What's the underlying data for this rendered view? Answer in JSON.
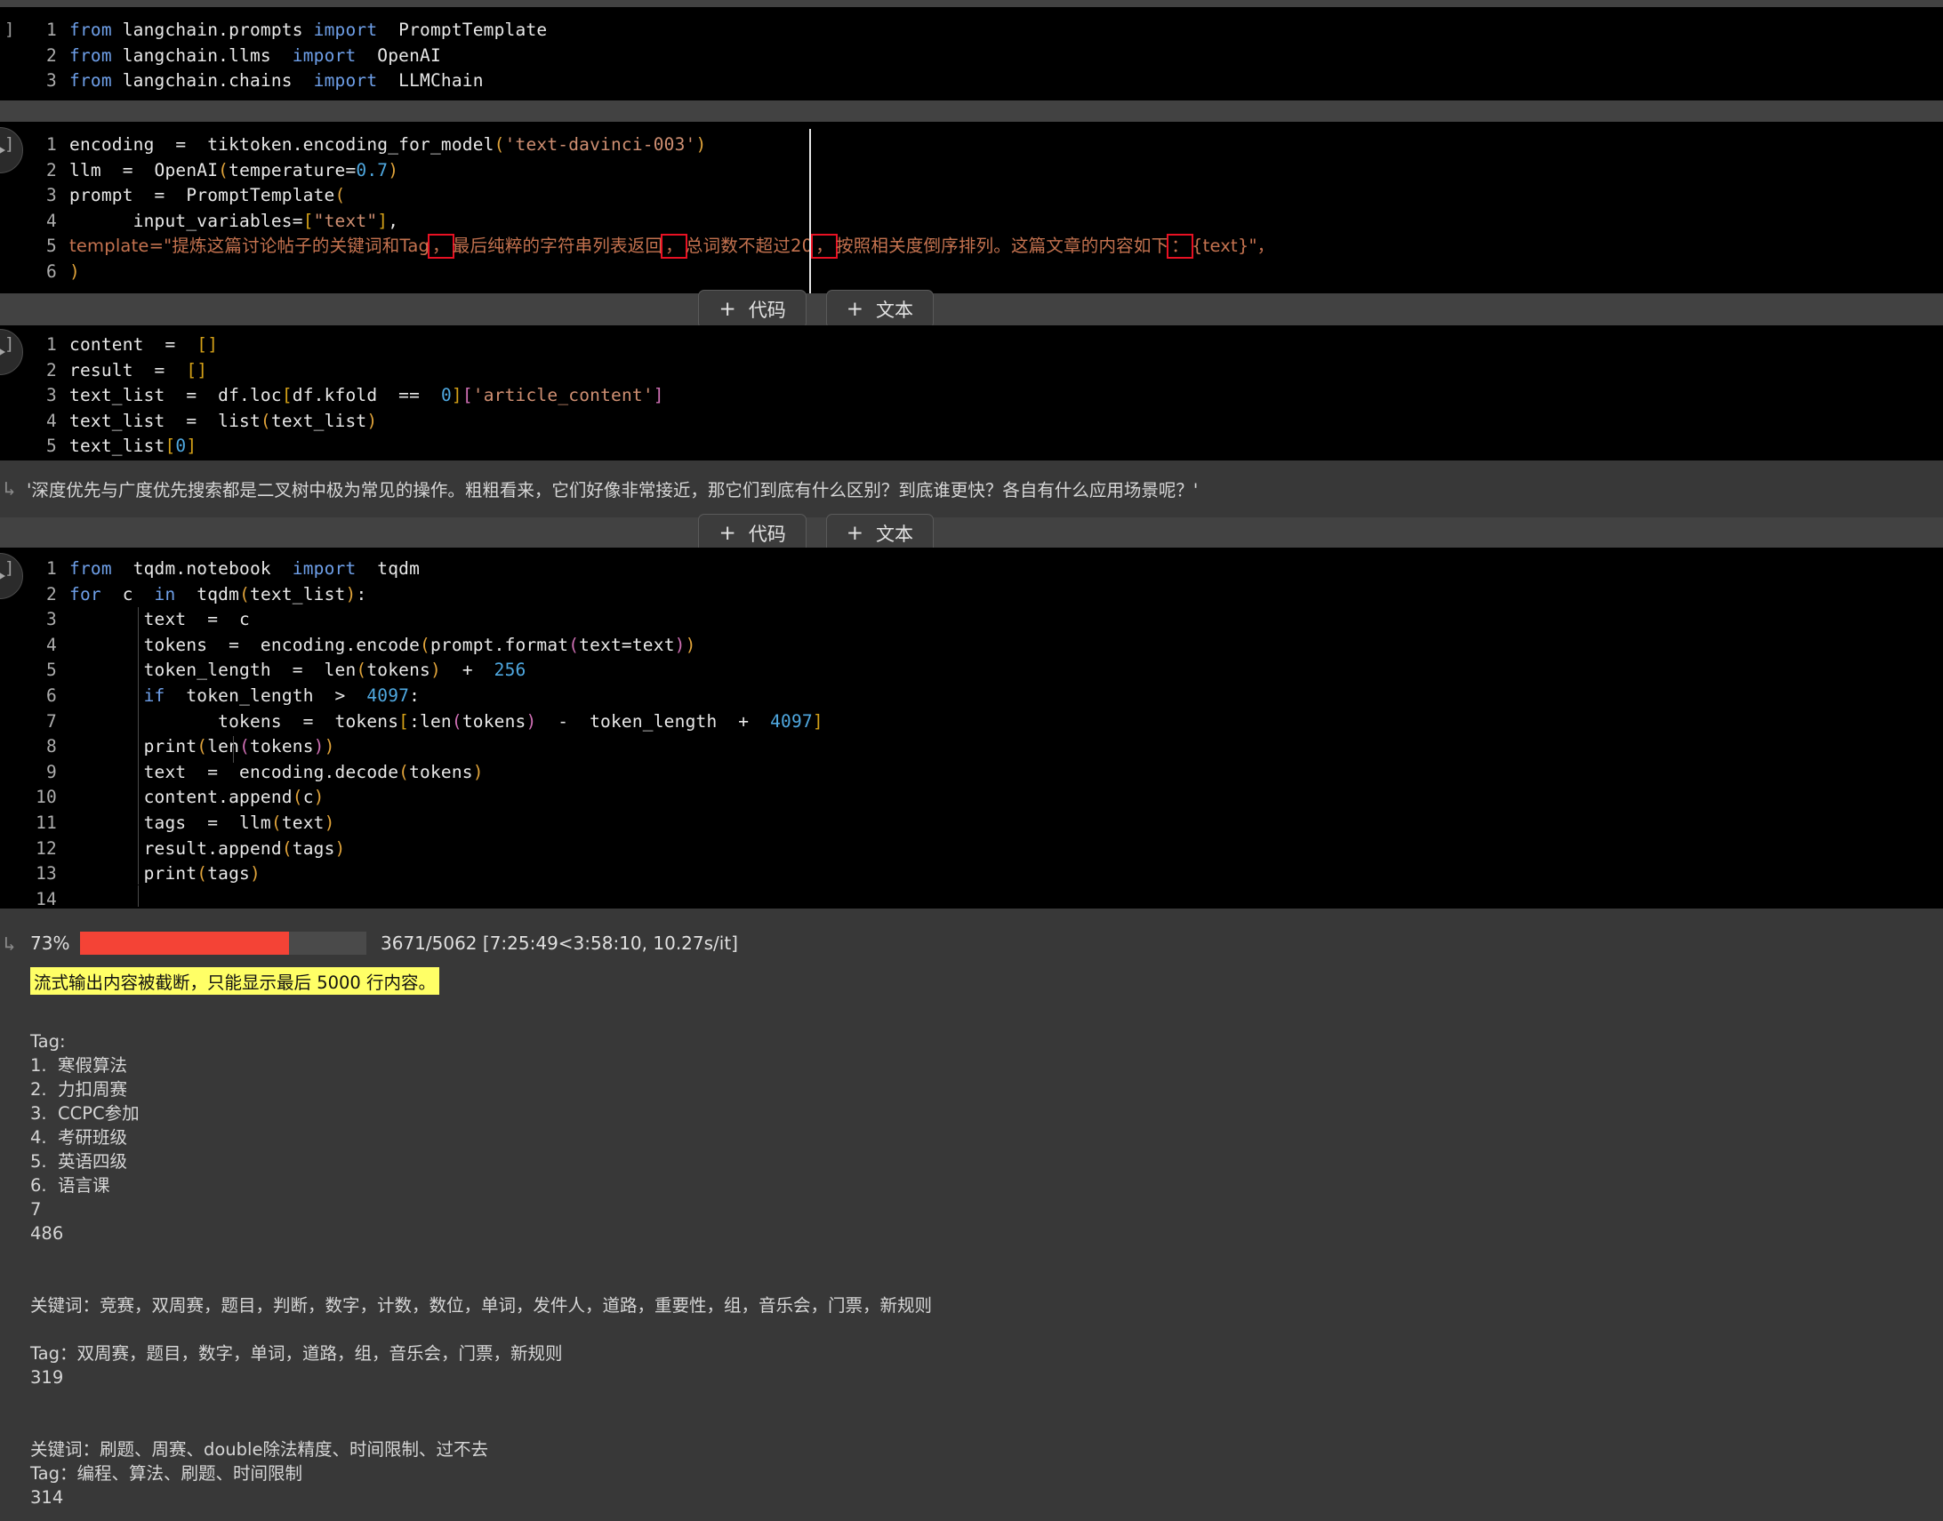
{
  "theme": {
    "page_bg": "#383838",
    "cell_bg": "#000000",
    "bar_bg": "#424242",
    "accent_red": "#f44336",
    "warn_bg": "#ffff66",
    "string_color": "#cf8f72",
    "keyword_color": "#6e9fe8"
  },
  "toolbar": {
    "add_code_label": "代码",
    "add_text_label": "文本",
    "plus": "+"
  },
  "cells": [
    {
      "id": "cell-imports",
      "prompt": "]",
      "lines": [
        {
          "n": "1",
          "tokens": [
            {
              "t": "from",
              "c": "kw"
            },
            {
              "t": " langchain.prompts ",
              "c": "plain"
            },
            {
              "t": "import",
              "c": "kw"
            },
            {
              "t": "  PromptTemplate",
              "c": "plain"
            }
          ]
        },
        {
          "n": "2",
          "tokens": [
            {
              "t": "from",
              "c": "kw"
            },
            {
              "t": " langchain.llms  ",
              "c": "plain"
            },
            {
              "t": "import",
              "c": "kw"
            },
            {
              "t": "  OpenAI",
              "c": "plain"
            }
          ]
        },
        {
          "n": "3",
          "tokens": [
            {
              "t": "from",
              "c": "kw"
            },
            {
              "t": " langchain.chains  ",
              "c": "plain"
            },
            {
              "t": "import",
              "c": "kw"
            },
            {
              "t": "  LLMChain",
              "c": "plain"
            }
          ]
        }
      ]
    },
    {
      "id": "cell-prompt-setup",
      "prompt": "]",
      "lines": [
        {
          "n": "1",
          "tokens": [
            {
              "t": "encoding  =  tiktoken.encoding_for_model",
              "c": "plain"
            },
            {
              "t": "(",
              "c": "paren"
            },
            {
              "t": "'text-davinci-003'",
              "c": "str"
            },
            {
              "t": ")",
              "c": "paren"
            }
          ]
        },
        {
          "n": "2",
          "tokens": [
            {
              "t": "llm  =  OpenAI",
              "c": "plain"
            },
            {
              "t": "(",
              "c": "paren"
            },
            {
              "t": "temperature=",
              "c": "plain"
            },
            {
              "t": "0.7",
              "c": "num"
            },
            {
              "t": ")",
              "c": "paren"
            }
          ]
        },
        {
          "n": "3",
          "tokens": [
            {
              "t": "prompt  =  PromptTemplate",
              "c": "plain"
            },
            {
              "t": "(",
              "c": "paren"
            }
          ]
        },
        {
          "n": "4",
          "tokens": [
            {
              "t": "      input_variables=",
              "c": "plain"
            },
            {
              "t": "[",
              "c": "brk"
            },
            {
              "t": "\"text\"",
              "c": "str"
            },
            {
              "t": "]",
              "c": "brk"
            },
            {
              "t": ",",
              "c": "plain"
            }
          ]
        },
        {
          "n": "5",
          "template_line": true
        },
        {
          "n": "6",
          "tokens": [
            {
              "t": ")",
              "c": "paren"
            }
          ]
        }
      ],
      "template_text": {
        "prefix": "template=\"提炼这篇讨论帖子的关键词和Tag",
        "boxed1": "，",
        "mid1": "最后纯粹的字符串列表返回",
        "boxed2": "，",
        "mid2": "总词数不超过20",
        "boxed3": "，",
        "mid3": "按照相关度倒序排列。这篇文章的内容如下",
        "boxed4": "：",
        "suffix": "{text}\"，"
      }
    },
    {
      "id": "cell-load-text",
      "prompt": "]",
      "lines": [
        {
          "n": "1",
          "tokens": [
            {
              "t": "content  =  ",
              "c": "plain"
            },
            {
              "t": "[]",
              "c": "brk"
            }
          ]
        },
        {
          "n": "2",
          "tokens": [
            {
              "t": "result  =  ",
              "c": "plain"
            },
            {
              "t": "[]",
              "c": "brk"
            }
          ]
        },
        {
          "n": "3",
          "tokens": [
            {
              "t": "text_list  =  df.loc",
              "c": "plain"
            },
            {
              "t": "[",
              "c": "brk"
            },
            {
              "t": "df.kfold  ==  ",
              "c": "plain"
            },
            {
              "t": "0",
              "c": "num"
            },
            {
              "t": "]",
              "c": "brk"
            },
            {
              "t": "[",
              "c": "brk2"
            },
            {
              "t": "'article_content'",
              "c": "str"
            },
            {
              "t": "]",
              "c": "brk2"
            }
          ]
        },
        {
          "n": "4",
          "tokens": [
            {
              "t": "text_list  =  list",
              "c": "plain"
            },
            {
              "t": "(",
              "c": "paren"
            },
            {
              "t": "text_list",
              "c": "plain"
            },
            {
              "t": ")",
              "c": "paren"
            }
          ]
        },
        {
          "n": "5",
          "tokens": [
            {
              "t": "text_list",
              "c": "plain"
            },
            {
              "t": "[",
              "c": "brk"
            },
            {
              "t": "0",
              "c": "num"
            },
            {
              "t": "]",
              "c": "brk"
            }
          ]
        }
      ]
    },
    {
      "id": "cell-main-loop",
      "prompt": "]",
      "lines": [
        {
          "n": "1",
          "tokens": [
            {
              "t": "from",
              "c": "kw"
            },
            {
              "t": " tqdm.notebook ",
              "c": "plain"
            },
            {
              "t": "import",
              "c": "kw"
            },
            {
              "t": " tqdm",
              "c": "plain"
            }
          ]
        },
        {
          "n": "2",
          "tokens": [
            {
              "t": "for",
              "c": "kw"
            },
            {
              "t": " c ",
              "c": "plain"
            },
            {
              "t": "in",
              "c": "kw"
            },
            {
              "t": " tqdm",
              "c": "plain"
            },
            {
              "t": "(",
              "c": "paren"
            },
            {
              "t": "text_list",
              "c": "plain"
            },
            {
              "t": ")",
              "c": "paren"
            },
            {
              "t": ":",
              "c": "plain"
            }
          ]
        },
        {
          "n": "3",
          "tokens": [
            {
              "t": "      text  =  c",
              "c": "plain"
            }
          ]
        },
        {
          "n": "4",
          "tokens": [
            {
              "t": "      tokens  =  encoding.encode",
              "c": "plain"
            },
            {
              "t": "(",
              "c": "paren"
            },
            {
              "t": "prompt.format",
              "c": "plain"
            },
            {
              "t": "(",
              "c": "brk2"
            },
            {
              "t": "text=text",
              "c": "plain"
            },
            {
              "t": ")",
              "c": "brk2"
            },
            {
              "t": ")",
              "c": "paren"
            }
          ]
        },
        {
          "n": "5",
          "tokens": [
            {
              "t": "      token_length  =  len",
              "c": "plain"
            },
            {
              "t": "(",
              "c": "paren"
            },
            {
              "t": "tokens",
              "c": "plain"
            },
            {
              "t": ")",
              "c": "paren"
            },
            {
              "t": "  +  ",
              "c": "plain"
            },
            {
              "t": "256",
              "c": "num"
            }
          ]
        },
        {
          "n": "6",
          "tokens": [
            {
              "t": "      ",
              "c": "plain"
            },
            {
              "t": "if",
              "c": "kw"
            },
            {
              "t": "  token_length  ",
              "c": "plain"
            },
            {
              "t": ">",
              "c": "plain"
            },
            {
              "t": "  ",
              "c": "plain"
            },
            {
              "t": "4097",
              "c": "num"
            },
            {
              "t": ":",
              "c": "plain"
            }
          ]
        },
        {
          "n": "7",
          "tokens": [
            {
              "t": "             tokens  =  tokens",
              "c": "plain"
            },
            {
              "t": "[",
              "c": "brk"
            },
            {
              "t": ":len",
              "c": "plain"
            },
            {
              "t": "(",
              "c": "brk2"
            },
            {
              "t": "tokens",
              "c": "plain"
            },
            {
              "t": ")",
              "c": "brk2"
            },
            {
              "t": "  -  token_length  +  ",
              "c": "plain"
            },
            {
              "t": "4097",
              "c": "num"
            },
            {
              "t": "]",
              "c": "brk"
            }
          ]
        },
        {
          "n": "8",
          "tokens": [
            {
              "t": "      print",
              "c": "plain"
            },
            {
              "t": "(",
              "c": "paren"
            },
            {
              "t": "len",
              "c": "plain"
            },
            {
              "t": "(",
              "c": "brk2"
            },
            {
              "t": "tokens",
              "c": "plain"
            },
            {
              "t": ")",
              "c": "brk2"
            },
            {
              "t": ")",
              "c": "paren"
            }
          ]
        },
        {
          "n": "9",
          "tokens": [
            {
              "t": "      text  =  encoding.decode",
              "c": "plain"
            },
            {
              "t": "(",
              "c": "paren"
            },
            {
              "t": "tokens",
              "c": "plain"
            },
            {
              "t": ")",
              "c": "paren"
            }
          ]
        },
        {
          "n": "10",
          "tokens": [
            {
              "t": "      content.append",
              "c": "plain"
            },
            {
              "t": "(",
              "c": "paren"
            },
            {
              "t": "c",
              "c": "plain"
            },
            {
              "t": ")",
              "c": "paren"
            }
          ]
        },
        {
          "n": "11",
          "tokens": [
            {
              "t": "      tags  =  llm",
              "c": "plain"
            },
            {
              "t": "(",
              "c": "paren"
            },
            {
              "t": "text",
              "c": "plain"
            },
            {
              "t": ")",
              "c": "paren"
            }
          ]
        },
        {
          "n": "12",
          "tokens": [
            {
              "t": "      result.append",
              "c": "plain"
            },
            {
              "t": "(",
              "c": "paren"
            },
            {
              "t": "tags",
              "c": "plain"
            },
            {
              "t": ")",
              "c": "paren"
            }
          ]
        },
        {
          "n": "13",
          "tokens": [
            {
              "t": "      print",
              "c": "plain"
            },
            {
              "t": "(",
              "c": "paren"
            },
            {
              "t": "tags",
              "c": "plain"
            },
            {
              "t": ")",
              "c": "paren"
            }
          ]
        },
        {
          "n": "14",
          "tokens": [
            {
              "t": "",
              "c": "plain"
            }
          ]
        }
      ]
    }
  ],
  "text_output": {
    "content": "'深度优先与广度优先搜索都是二叉树中极为常见的操作。粗粗看来，它们好像非常接近，那它们到底有什么区别？到底谁更快？各自有什么应用场景呢？'"
  },
  "run_output": {
    "progress": {
      "percent_label": "73%",
      "percent_value": 73,
      "stats": "3671/5062 [7:25:49<3:58:10, 10.27s/it]"
    },
    "truncation_warning": "流式输出内容被截断，只能显示最后 5000 行内容。",
    "lines": [
      "",
      "Tag:",
      "1.  寒假算法",
      "2.  力扣周赛",
      "3.  CCPC参加",
      "4.  考研班级",
      "5.  英语四级",
      "6.  语言课",
      "7",
      "486",
      "",
      "",
      "关键词：竞赛，双周赛，题目，判断，数字，计数，数位，单词，发件人，道路，重要性，组，音乐会，门票，新规则",
      "",
      "Tag：双周赛，题目，数字，单词，道路，组，音乐会，门票，新规则",
      "319",
      "",
      "",
      "关键词：刷题、周赛、double除法精度、时间限制、过不去",
      "Tag：编程、算法、刷题、时间限制",
      "314"
    ]
  }
}
